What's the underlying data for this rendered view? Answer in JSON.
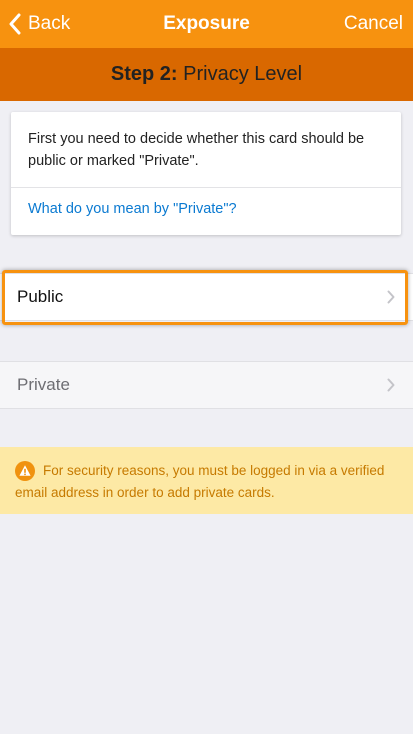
{
  "navbar": {
    "back_label": "Back",
    "title": "Exposure",
    "cancel_label": "Cancel"
  },
  "step": {
    "number": "Step 2:",
    "name": "Privacy Level"
  },
  "info_card": {
    "text": "First you need to decide whether this card should be public or marked \"Private\".",
    "link": "What do you mean by \"Private\"?"
  },
  "options": [
    {
      "label": "Public",
      "selected": true
    },
    {
      "label": "Private",
      "selected": false
    }
  ],
  "warning": {
    "icon": "warning-icon",
    "text": "For security reasons, you must be logged in via a verified email address in order to add private cards."
  },
  "colors": {
    "accent": "#f7920f",
    "step_bar": "#d96800",
    "link": "#0b7ad1",
    "warning_bg": "#fde9a5",
    "warning_text": "#c67a00"
  }
}
